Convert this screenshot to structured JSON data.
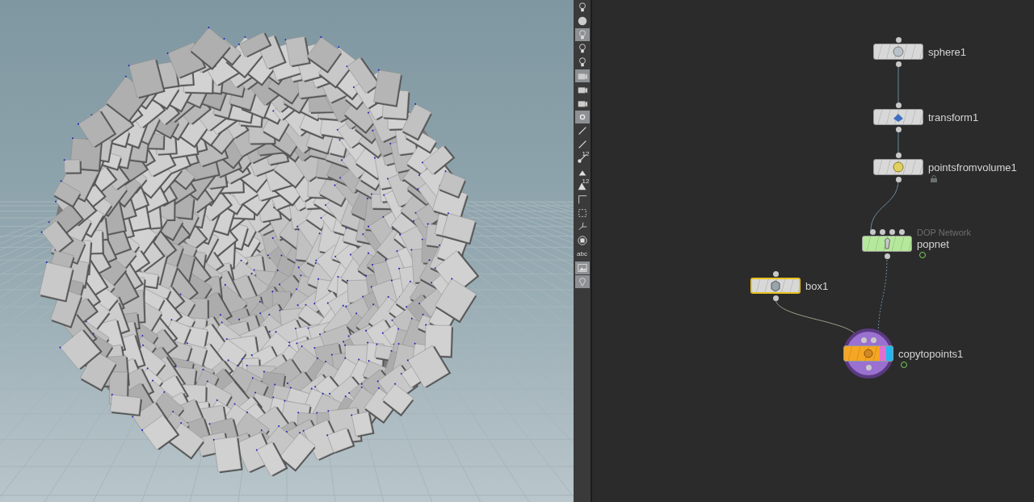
{
  "toolbar": {
    "tools": [
      {
        "kind": "bulb",
        "selected": false
      },
      {
        "kind": "sphere",
        "selected": false
      },
      {
        "kind": "bulb",
        "selected": true
      },
      {
        "kind": "bulb",
        "selected": false
      },
      {
        "kind": "bulb",
        "selected": false
      },
      {
        "kind": "camera",
        "selected": true
      },
      {
        "kind": "camera",
        "selected": false
      },
      {
        "kind": "camera",
        "selected": false
      },
      {
        "kind": "dot",
        "selected": true
      },
      {
        "kind": "pen",
        "selected": false
      },
      {
        "kind": "pen",
        "selected": false
      },
      {
        "kind": "numbered",
        "selected": false,
        "label": "12"
      },
      {
        "kind": "brush",
        "selected": false
      },
      {
        "kind": "numbered-brush",
        "selected": false,
        "label": "12"
      },
      {
        "kind": "corner",
        "selected": false
      },
      {
        "kind": "grid",
        "selected": false
      },
      {
        "kind": "scatter",
        "selected": false
      },
      {
        "kind": "square",
        "selected": false
      },
      {
        "kind": "text",
        "selected": false,
        "label": "abc"
      },
      {
        "kind": "image",
        "selected": true
      },
      {
        "kind": "pin",
        "selected": true
      }
    ]
  },
  "network": {
    "nodes": [
      {
        "name": "sphere1",
        "kind": "sphere",
        "selected": false,
        "display": false,
        "locked": false,
        "time_dependent": false
      },
      {
        "name": "transform1",
        "kind": "transform",
        "selected": false,
        "display": false,
        "locked": false,
        "time_dependent": false
      },
      {
        "name": "pointsfromvolume1",
        "kind": "volume",
        "selected": false,
        "display": false,
        "locked": true,
        "time_dependent": false
      },
      {
        "name": "popnet",
        "subtitle": "DOP Network",
        "kind": "dop",
        "selected": false,
        "display": false,
        "locked": false,
        "time_dependent": true
      },
      {
        "name": "box1",
        "kind": "box",
        "selected": true,
        "display": false,
        "locked": false,
        "time_dependent": false
      },
      {
        "name": "copytopoints1",
        "kind": "copy",
        "selected": false,
        "display": true,
        "locked": false,
        "time_dependent": true
      }
    ]
  }
}
